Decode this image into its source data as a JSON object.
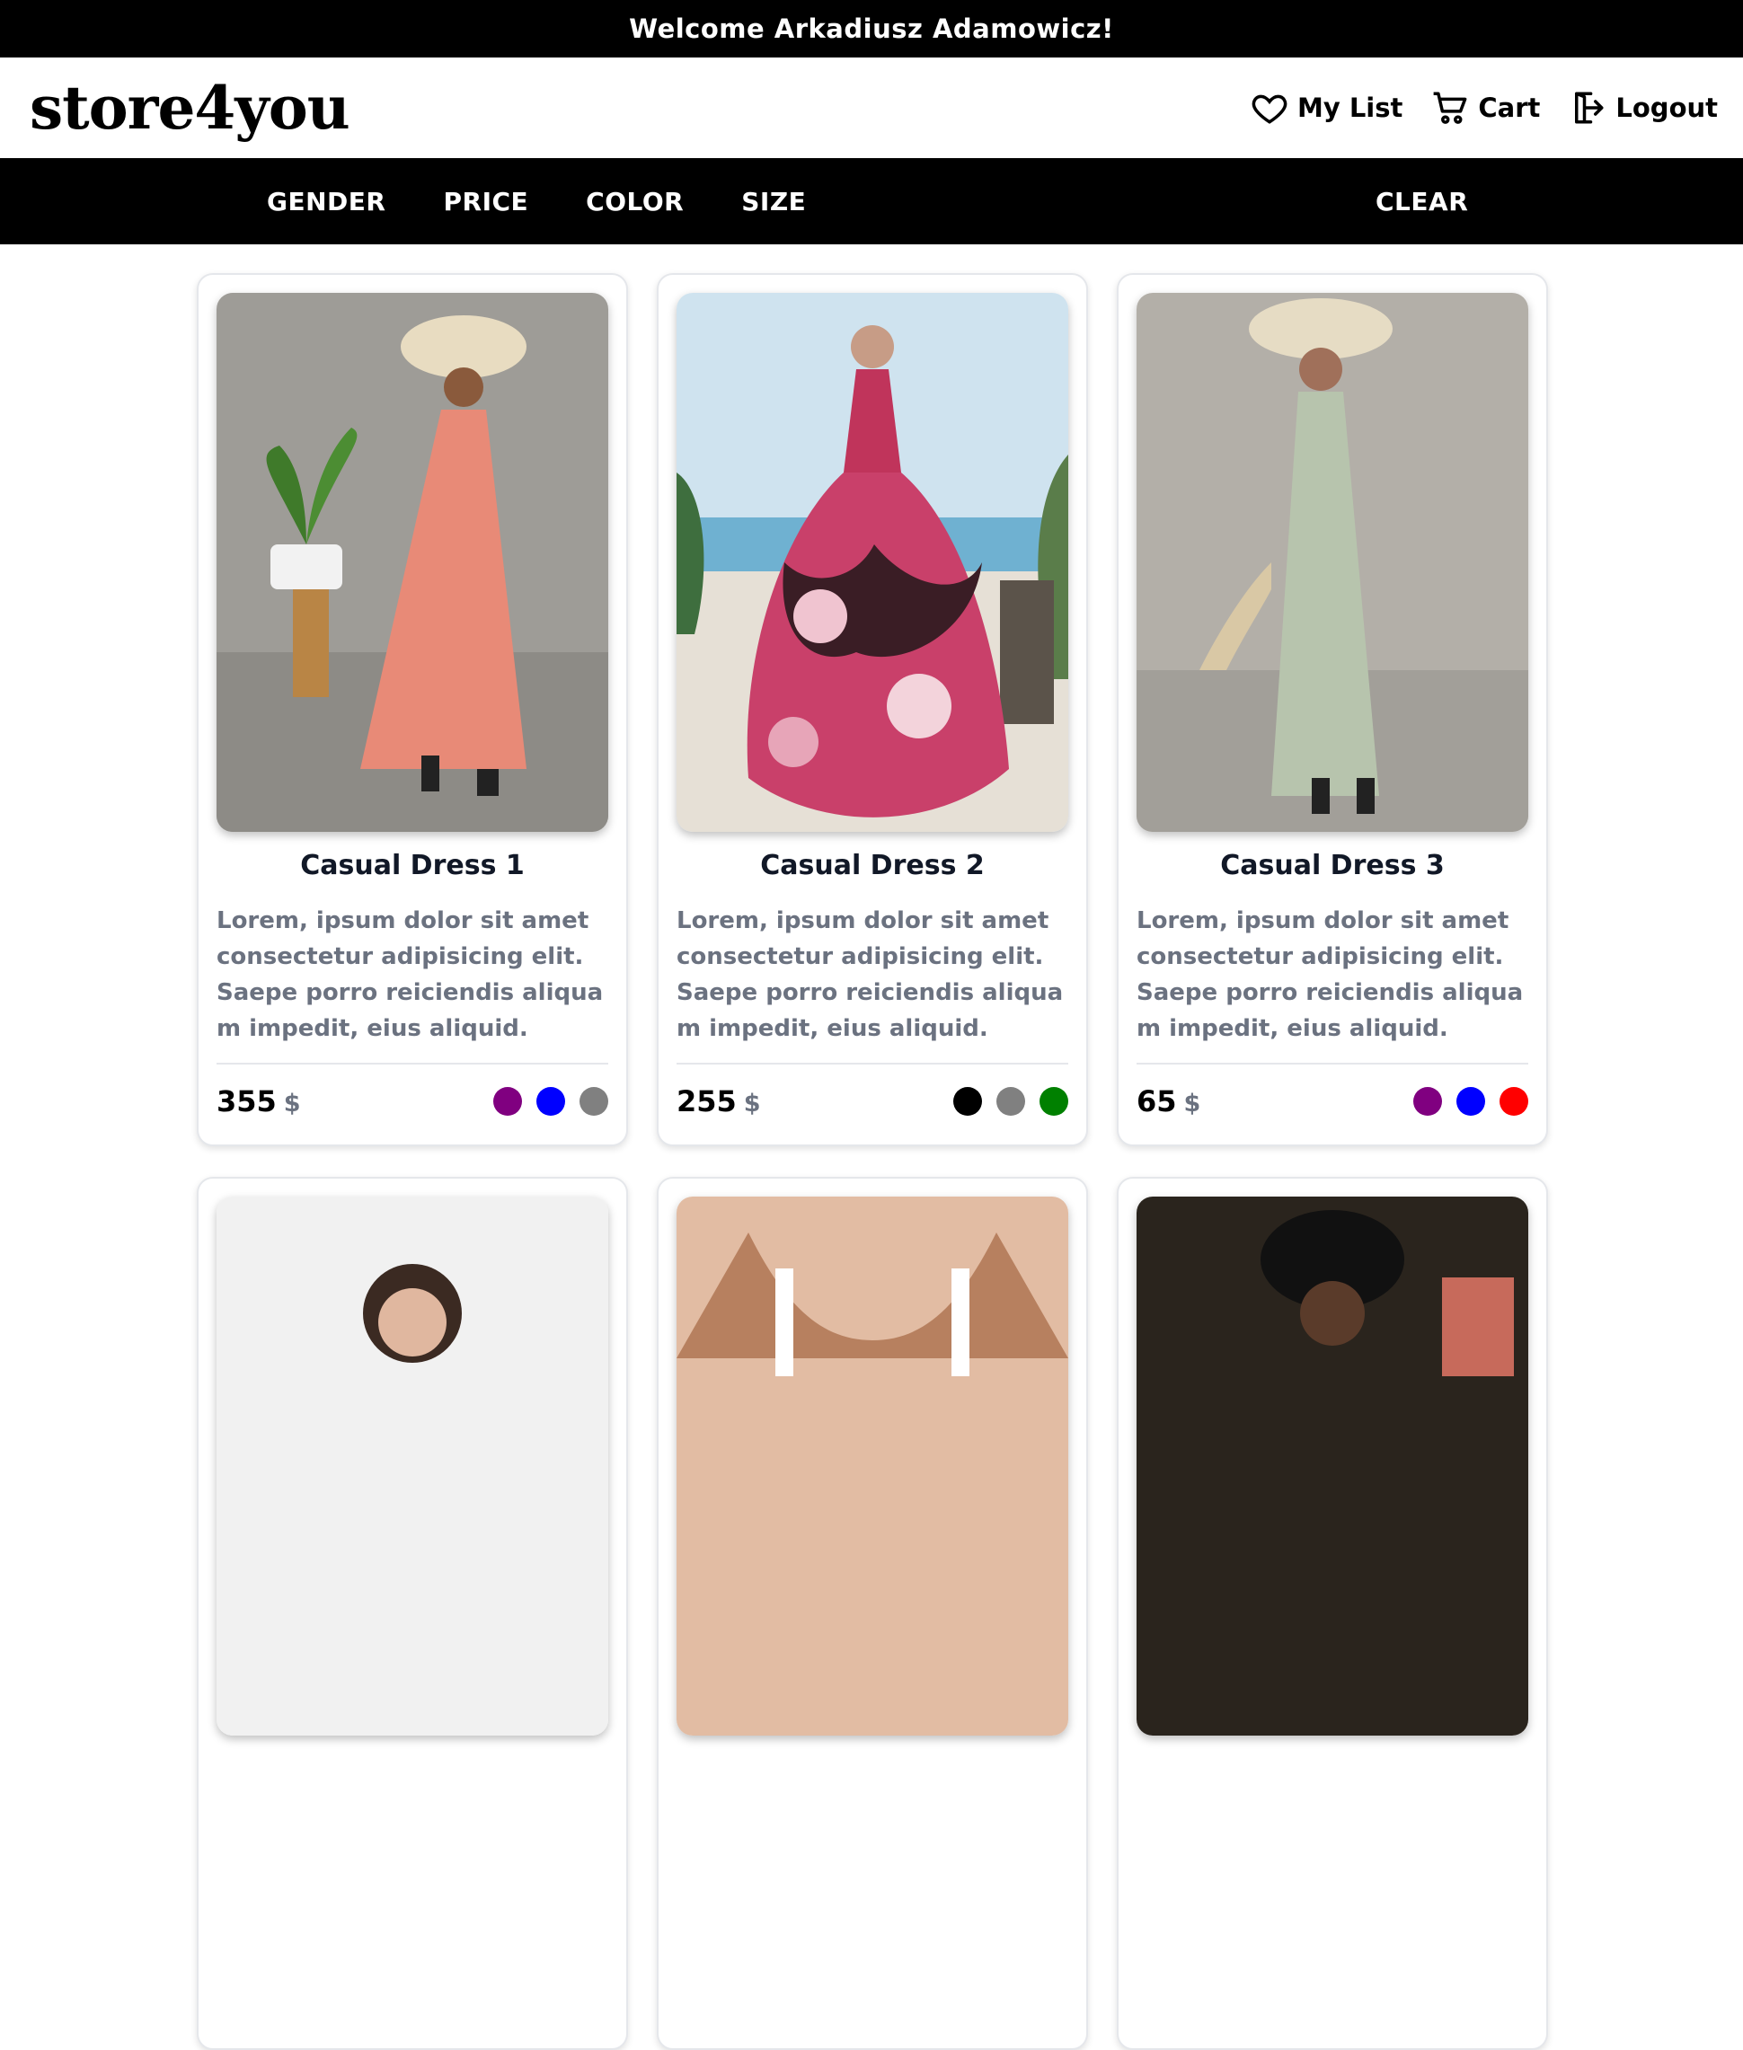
{
  "welcome": {
    "text": "Welcome Arkadiusz Adamowicz!"
  },
  "header": {
    "logo": "store4you",
    "nav": [
      {
        "label": "My List",
        "icon": "heart-icon"
      },
      {
        "label": "Cart",
        "icon": "cart-icon"
      },
      {
        "label": "Logout",
        "icon": "logout-icon"
      }
    ]
  },
  "filters": {
    "items": [
      "GENDER",
      "PRICE",
      "COLOR",
      "SIZE"
    ],
    "clear_label": "CLEAR"
  },
  "products": [
    {
      "title": "Casual Dress 1",
      "description": "Lorem, ipsum dolor sit amet consectetur adipisicing elit. Saepe porro reiciendis aliquam impedit, eius aliquid.",
      "price": "355",
      "currency": "$",
      "colors": [
        "#800080",
        "#0000ff",
        "#808080"
      ]
    },
    {
      "title": "Casual Dress 2",
      "description": "Lorem, ipsum dolor sit amet consectetur adipisicing elit. Saepe porro reiciendis aliquam impedit, eius aliquid.",
      "price": "255",
      "currency": "$",
      "colors": [
        "#000000",
        "#808080",
        "#008000"
      ]
    },
    {
      "title": "Casual Dress 3",
      "description": "Lorem, ipsum dolor sit amet consectetur adipisicing elit. Saepe porro reiciendis aliquam impedit, eius aliquid.",
      "price": "65",
      "currency": "$",
      "colors": [
        "#800080",
        "#0000ff",
        "#ff0000"
      ]
    }
  ]
}
